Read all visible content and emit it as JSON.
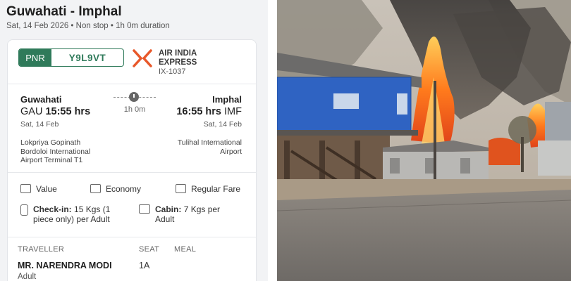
{
  "header": {
    "route": "Guwahati - Imphal",
    "subtitle": "Sat, 14 Feb 2026 • Non stop • 1h 0m duration"
  },
  "booking": {
    "pnr_label": "PNR",
    "pnr_value": "Y9L9VT",
    "airline": "AIR INDIA EXPRESS",
    "flight_no": "IX-1037",
    "brand_color": "#e8582a",
    "pnr_color": "#2f7a5a"
  },
  "departure": {
    "city": "Guwahati",
    "code": "GAU",
    "time": "15:55 hrs",
    "date": "Sat, 14 Feb",
    "airport_lines": [
      "Lokpriya Gopinath",
      "Bordoloi International",
      "Airport Terminal T1"
    ]
  },
  "arrival": {
    "city": "Imphal",
    "code": "IMF",
    "time": "16:55 hrs",
    "date": "Sat, 14 Feb",
    "airport_lines": [
      "Tulihal International",
      "Airport"
    ]
  },
  "duration": "1h 0m",
  "fare": {
    "value_label": "Value",
    "class_label": "Economy",
    "fare_type": "Regular Fare"
  },
  "baggage": {
    "checkin_label": "Check-in:",
    "checkin_value_1": "15 Kgs (1",
    "checkin_value_2": "piece only) per Adult",
    "cabin_label": "Cabin:",
    "cabin_value_1": "7 Kgs per",
    "cabin_value_2": "Adult"
  },
  "travellers": {
    "headers": [
      "TRAVELLER",
      "SEAT",
      "MEAL"
    ],
    "rows": [
      {
        "name": "MR. NARENDRA MODI",
        "seat": "1A",
        "meal": "",
        "type": "Adult"
      }
    ]
  },
  "photo": {
    "subject": "house-fire-photo"
  }
}
